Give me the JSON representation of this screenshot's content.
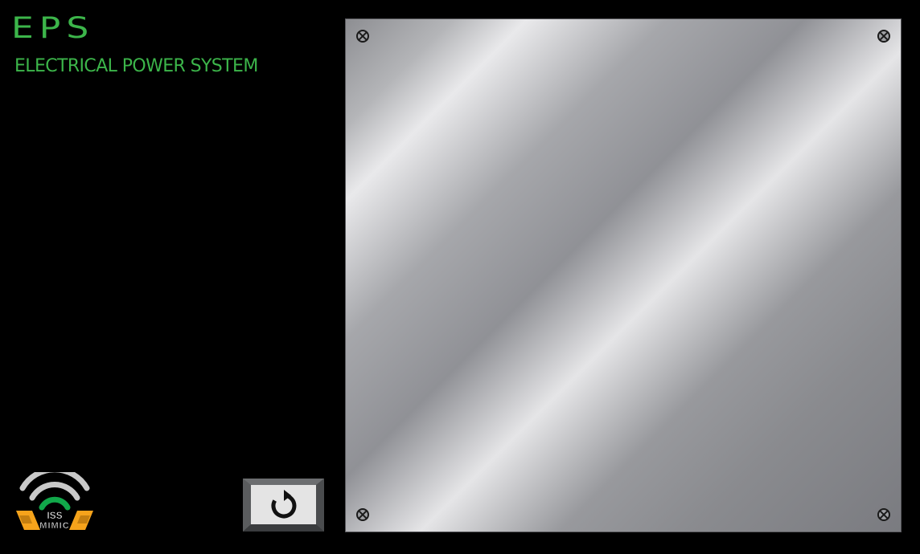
{
  "header": {
    "title": "EPS",
    "subtitle": "ELECTRICAL POWER SYSTEM"
  },
  "logo": {
    "text_top": "ISS",
    "text_bottom": "MIMIC",
    "icon": "iss-mimic-logo"
  },
  "back_button": {
    "icon": "refresh-arrow-icon"
  },
  "panel": {
    "screw_icon": "screw-icon"
  },
  "colors": {
    "background": "#000000",
    "accent_green": "#3cb54a",
    "logo_gray": "#c9c9c9",
    "logo_orange": "#f6a31b",
    "logo_green": "#11a84a"
  }
}
